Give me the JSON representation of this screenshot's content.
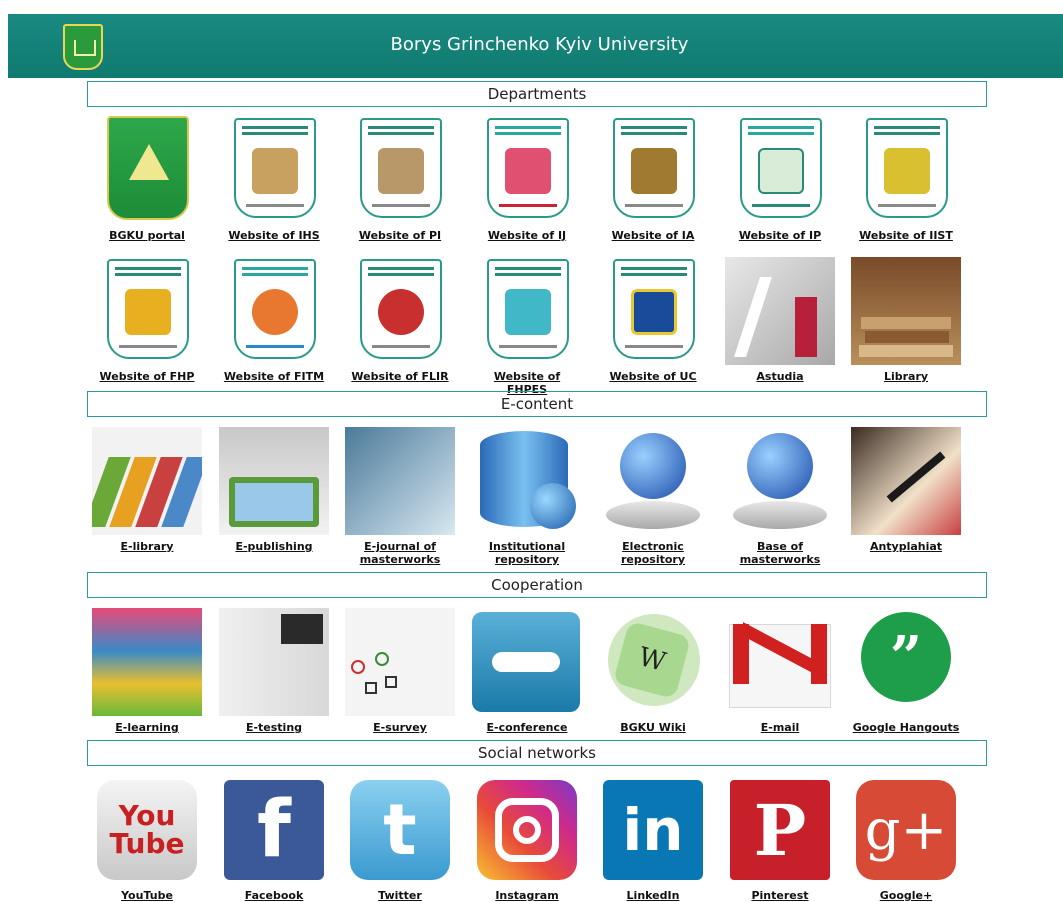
{
  "header": {
    "title": "Borys Grinchenko Kyiv University"
  },
  "sections": {
    "departments": "Departments",
    "econtent": "E-content",
    "cooperation": "Cooperation",
    "social": "Social networks"
  },
  "departments_row1": [
    {
      "label": "BGKU portal"
    },
    {
      "label": "Website of IHS"
    },
    {
      "label": "Website of PI"
    },
    {
      "label": "Website of IJ"
    },
    {
      "label": "Website of IA"
    },
    {
      "label": "Website of IP"
    },
    {
      "label": "Website of IIST"
    }
  ],
  "departments_row2": [
    {
      "label": "Website of FHP"
    },
    {
      "label": "Website of FITM"
    },
    {
      "label": "Website of FLIR"
    },
    {
      "label": "Website of FHPES"
    },
    {
      "label": "Website of UC"
    },
    {
      "label": "Astudia"
    },
    {
      "label": "Library"
    }
  ],
  "econtent": [
    {
      "label": "E-library"
    },
    {
      "label": "E-publishing"
    },
    {
      "label": "E-journal of masterworks"
    },
    {
      "label": "Institutional repository"
    },
    {
      "label": "Electronic repository"
    },
    {
      "label": "Base of masterworks"
    },
    {
      "label": "Antyplahiat"
    }
  ],
  "cooperation": [
    {
      "label": "E-learning"
    },
    {
      "label": "E-testing"
    },
    {
      "label": "E-survey"
    },
    {
      "label": "E-conference"
    },
    {
      "label": "BGKU Wiki"
    },
    {
      "label": "E-mail"
    },
    {
      "label": "Google Hangouts"
    }
  ],
  "social": [
    {
      "label": "YouTube",
      "color": "#cc2222"
    },
    {
      "label": "Facebook",
      "color": "#3b5998"
    },
    {
      "label": "Twitter",
      "color": "#4aa8d8"
    },
    {
      "label": "Instagram",
      "color": "#d6287a"
    },
    {
      "label": "LinkedIn",
      "color": "#0a77b5"
    },
    {
      "label": "Pinterest",
      "color": "#c8202a"
    },
    {
      "label": "Google+",
      "color": "#d64a36"
    }
  ],
  "social_glyphs": {
    "youtube": "You Tube",
    "facebook": "f",
    "twitter": "t",
    "linkedin": "in",
    "pinterest": "P",
    "googleplus": "g+",
    "hangouts": "”",
    "wiki": "W"
  }
}
